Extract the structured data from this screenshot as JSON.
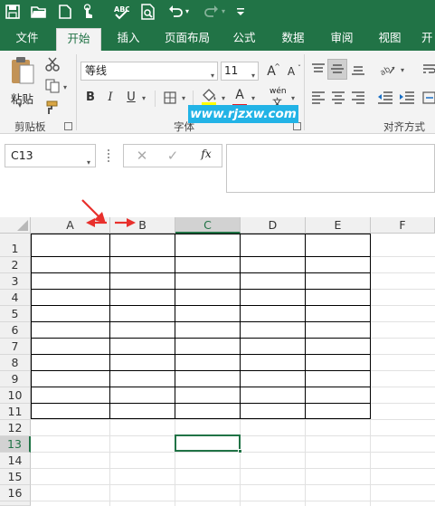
{
  "qat": {
    "icons": [
      "save-icon",
      "open-folder-icon",
      "new-file-icon",
      "touch-mode-icon",
      "spelling-check-icon",
      "print-preview-icon",
      "undo-icon",
      "redo-icon",
      "customize-qat-icon"
    ]
  },
  "tabs": [
    "文件",
    "开始",
    "插入",
    "页面布局",
    "公式",
    "数据",
    "审阅",
    "视图",
    "开"
  ],
  "ribbon": {
    "paste_label": "粘贴",
    "clipboard_label": "剪贴板",
    "font_group_label": "字体",
    "alignment_group_label": "对齐方式",
    "font_name": "等线",
    "font_size": "11",
    "bold": "B",
    "italic": "I",
    "underline": "U",
    "increase_font": "A",
    "decrease_font": "A",
    "font_color_letter": "A",
    "phonetic_top": "wén",
    "phonetic_bottom": "文",
    "watermark": "www.rjzxw.com"
  },
  "formula_bar": {
    "name_box": "C13",
    "fx_label": "fx",
    "formula_value": ""
  },
  "sheet": {
    "columns": [
      "A",
      "B",
      "C",
      "D",
      "E",
      "F"
    ],
    "rows": [
      "1",
      "2",
      "3",
      "4",
      "5",
      "6",
      "7",
      "8",
      "9",
      "10",
      "11",
      "12",
      "13",
      "14",
      "15",
      "16"
    ],
    "selected_cell": "C13",
    "bordered_range": "A1:E11"
  },
  "colors": {
    "excel_green": "#217346",
    "annotation_red": "#e8302c",
    "watermark_blue": "#22b3e6"
  }
}
